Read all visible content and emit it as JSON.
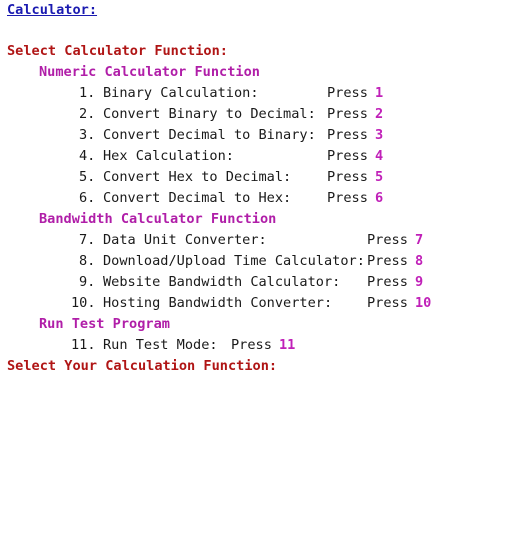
{
  "title_link": "Calculator:",
  "header": "Select Calculator Function:",
  "sections": [
    {
      "heading": "Numeric Calculator Function",
      "items": [
        {
          "num": "1.",
          "label": "Binary Calculation:",
          "press": "Press",
          "key": "1"
        },
        {
          "num": "2.",
          "label": "Convert Binary to Decimal:",
          "press": "Press",
          "key": "2"
        },
        {
          "num": "3.",
          "label": "Convert Decimal to Binary:",
          "press": "Press",
          "key": "3"
        },
        {
          "num": "4.",
          "label": "Hex Calculation:",
          "press": "Press",
          "key": "4"
        },
        {
          "num": "5.",
          "label": "Convert Hex to Decimal:",
          "press": "Press",
          "key": "5"
        },
        {
          "num": "6.",
          "label": "Convert Decimal to Hex:",
          "press": "Press",
          "key": "6"
        }
      ]
    },
    {
      "heading": "Bandwidth Calculator Function",
      "items": [
        {
          "num": "7.",
          "label": "Data Unit Converter:",
          "press": "Press",
          "key": "7"
        },
        {
          "num": "8.",
          "label": "Download/Upload Time Calculator:",
          "press": "Press",
          "key": "8"
        },
        {
          "num": "9.",
          "label": "Website Bandwidth Calculator:",
          "press": "Press",
          "key": "9"
        },
        {
          "num": "10.",
          "label": "Hosting Bandwidth Converter:",
          "press": "Press",
          "key": "10"
        }
      ]
    },
    {
      "heading": "Run Test Program",
      "items": [
        {
          "num": "11.",
          "label": "Run Test Mode:",
          "press": "Press",
          "key": "11"
        }
      ]
    }
  ],
  "prompt": "Select Your Calculation Function:",
  "colors": {
    "link": "#1a1ab0",
    "header_red": "#b01515",
    "section_magenta": "#b01ea8",
    "key_magenta": "#c020b8",
    "text": "#1a1a1a",
    "background": "#ffffff"
  }
}
